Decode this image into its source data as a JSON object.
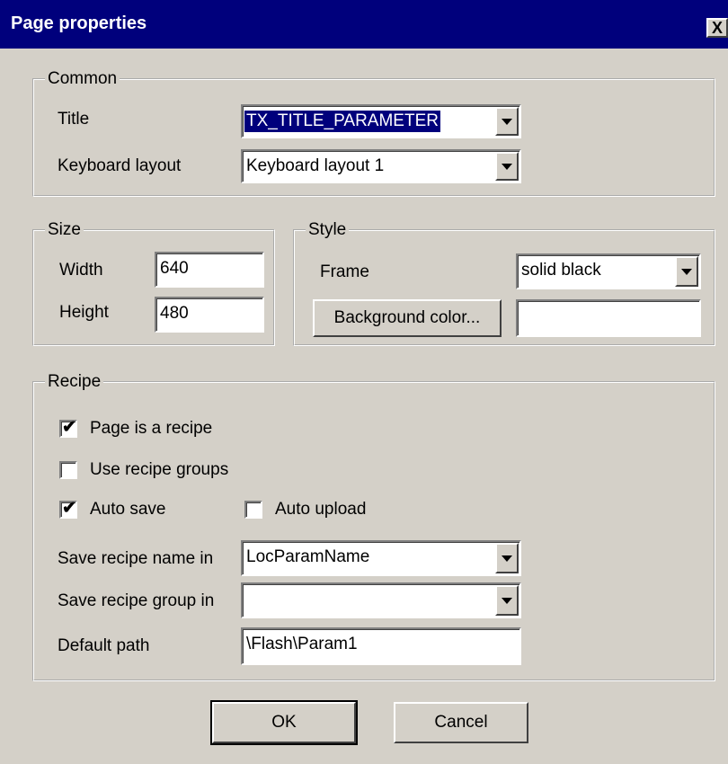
{
  "dialog": {
    "title": "Page properties",
    "close_glyph": "X"
  },
  "common": {
    "legend": "Common",
    "title_label": "Title",
    "title_value": "TX_TITLE_PARAMETER",
    "keyboard_label": "Keyboard layout",
    "keyboard_value": "Keyboard layout 1"
  },
  "size": {
    "legend": "Size",
    "width_label": "Width",
    "width_value": "640",
    "height_label": "Height",
    "height_value": "480"
  },
  "style": {
    "legend": "Style",
    "frame_label": "Frame",
    "frame_value": "solid black",
    "bg_button": "Background color...",
    "bg_value": ""
  },
  "recipe": {
    "legend": "Recipe",
    "page_is_recipe": {
      "label": "Page is a recipe",
      "checked": true
    },
    "use_groups": {
      "label": "Use recipe groups",
      "checked": false
    },
    "auto_save": {
      "label": "Auto save",
      "checked": true
    },
    "auto_upload": {
      "label": "Auto upload",
      "checked": false
    },
    "name_label": "Save recipe name in",
    "name_value": "LocParamName",
    "group_label": "Save recipe group in",
    "group_value": "",
    "path_label": "Default path",
    "path_value": "\\Flash\\Param1"
  },
  "buttons": {
    "ok": "OK",
    "cancel": "Cancel"
  },
  "check_glyph": "✔"
}
